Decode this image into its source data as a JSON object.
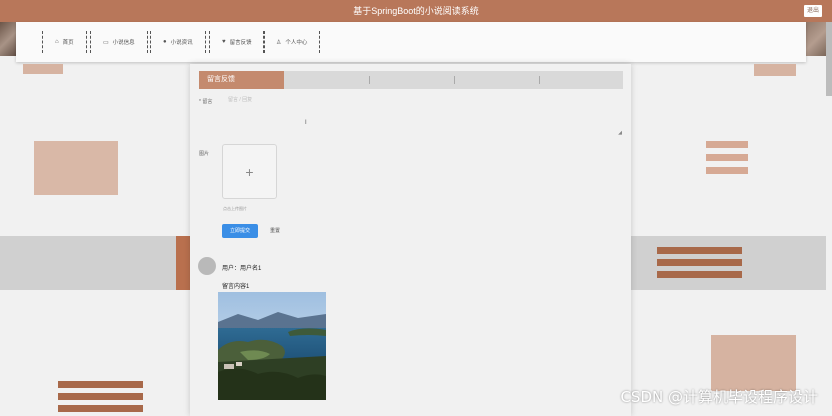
{
  "app": {
    "title": "基于SpringBoot的小说阅读系统",
    "exit_label": "退出"
  },
  "nav": {
    "items": [
      {
        "label": "首页",
        "icon": "home-icon"
      },
      {
        "label": "小说信息",
        "icon": "book-icon"
      },
      {
        "label": "小说资讯",
        "icon": "news-icon"
      },
      {
        "label": "留言反馈",
        "icon": "feedback-icon"
      },
      {
        "label": "个人中心",
        "icon": "user-icon"
      }
    ]
  },
  "tabs": {
    "active": "留言反馈"
  },
  "form": {
    "message_label": "* 留言",
    "message_placeholder": "留言 / 回复",
    "image_label": "图片",
    "upload_hint": "点击上传图片",
    "submit_label": "立即提交",
    "reset_label": "重置"
  },
  "feed": {
    "user_line": "用户：用户名1",
    "content_line": "留言内容1"
  },
  "watermark": "CSDN @计算机毕设程序设计",
  "colors": {
    "brand": "#b8775a",
    "accent_blue": "#3a8ee6",
    "stripe": "#a8694a"
  }
}
